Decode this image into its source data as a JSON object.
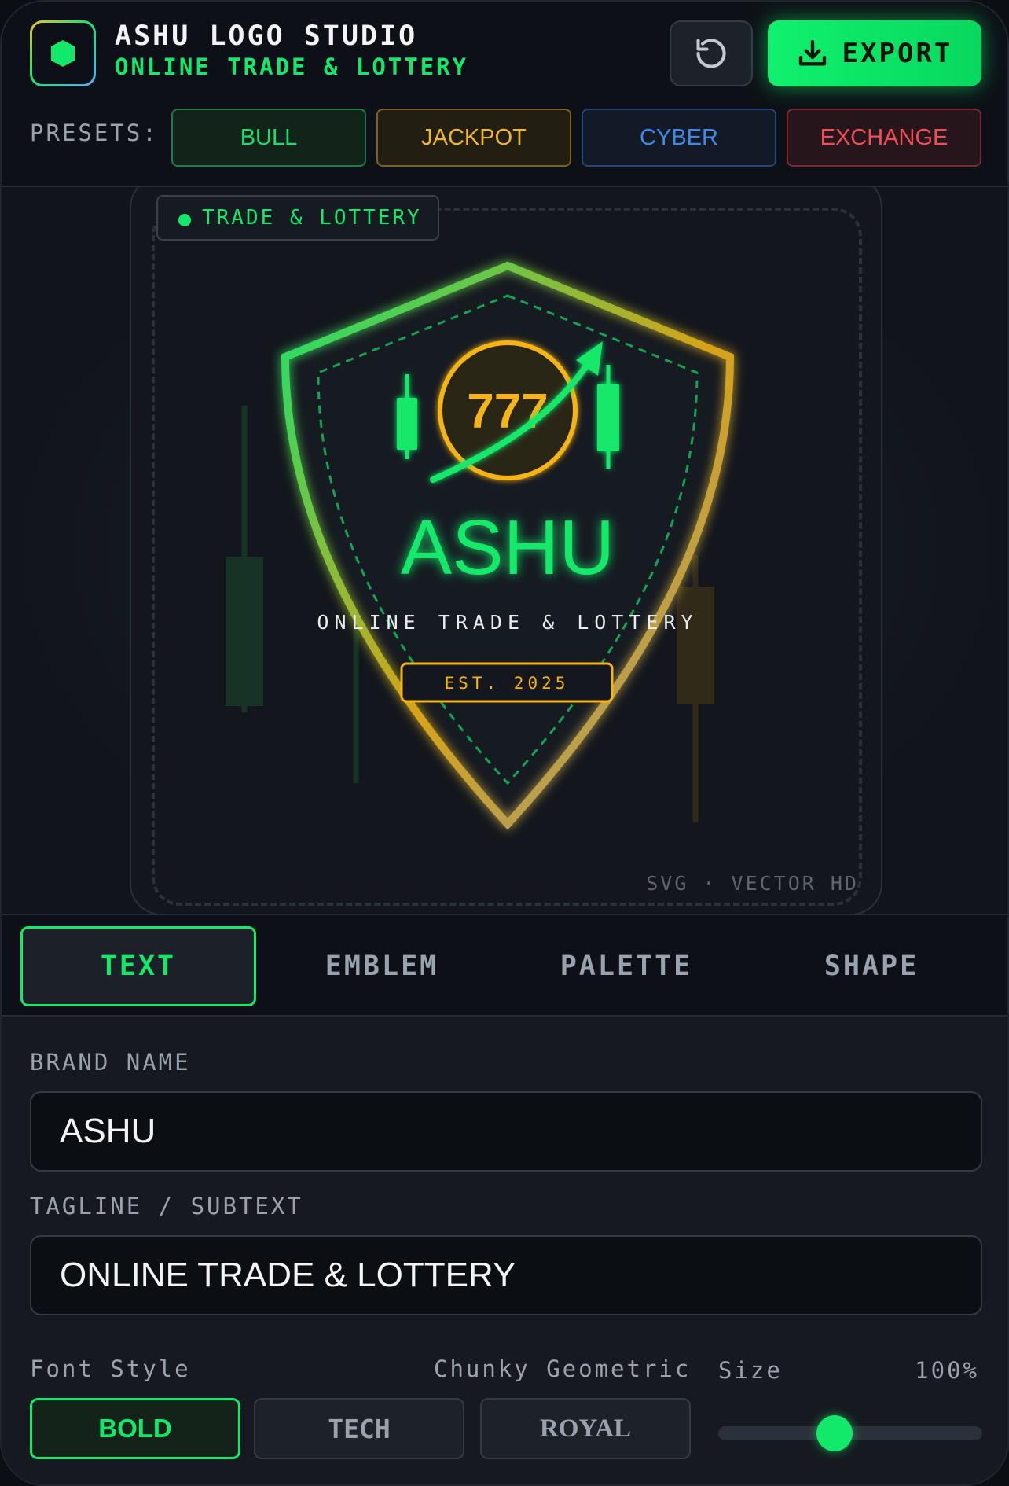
{
  "header": {
    "title": "ASHU LOGO STUDIO",
    "subtitle": "ONLINE TRADE & LOTTERY",
    "export_label": "EXPORT",
    "presets_label": "PRESETS:",
    "presets": [
      "BULL",
      "JACKPOT",
      "CYBER",
      "EXCHANGE"
    ]
  },
  "canvas": {
    "badge": "TRADE & LOTTERY",
    "emblem_number": "777",
    "brand": "ASHU",
    "tagline": "ONLINE TRADE & LOTTERY",
    "established": "EST. 2025",
    "watermark": "SVG · VECTOR HD"
  },
  "tabs": [
    "TEXT",
    "EMBLEM",
    "PALETTE",
    "SHAPE"
  ],
  "text_panel": {
    "brand_name_label": "BRAND NAME",
    "brand_name_value": "ASHU",
    "tagline_label": "TAGLINE / SUBTEXT",
    "tagline_value": "ONLINE TRADE & LOTTERY",
    "font_style_label": "Font Style",
    "font_style_value": "Chunky Geometric",
    "font_options": [
      "BOLD",
      "TECH",
      "ROYAL"
    ],
    "size_label": "Size",
    "size_value": "100%",
    "size_level": 0.44
  },
  "colors": {
    "accent": "#12e86a",
    "gold": "#f5b418",
    "background": "#0e1218"
  },
  "icons": {
    "app_logo": "hexagon-icon",
    "reset": "rotate-ccw-icon",
    "export": "download-icon"
  }
}
